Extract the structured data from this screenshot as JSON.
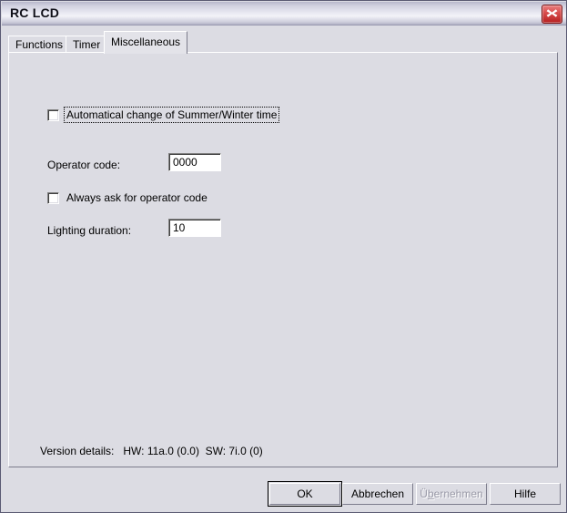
{
  "window": {
    "title": "RC LCD",
    "close_icon": "close-icon"
  },
  "tabs": [
    {
      "label": "Functions",
      "selected": false
    },
    {
      "label": "Timer",
      "selected": false
    },
    {
      "label": "Miscellaneous",
      "selected": true
    }
  ],
  "form": {
    "summer_winter": {
      "label": "Automatical change of Summer/Winter time",
      "checked": false,
      "focused": true
    },
    "operator_code": {
      "label": "Operator code:",
      "value": "0000"
    },
    "always_ask": {
      "label": "Always ask for operator code",
      "checked": false
    },
    "lighting_duration": {
      "label": "Lighting duration:",
      "value": "10"
    }
  },
  "version": {
    "label": "Version details:",
    "hardware": "HW: 11a.0 (0.0)",
    "software": "SW: 7i.0 (0)",
    "full_text": "Version details:   HW: 11a.0 (0.0)  SW: 7i.0 (0)"
  },
  "buttons": {
    "ok": "OK",
    "cancel": "Abbrechen",
    "apply_before": "Ü",
    "apply_accel": "b",
    "apply_after": "ernehmen",
    "apply_full": "Übernehmen",
    "help": "Hilfe"
  },
  "colors": {
    "dialog_background": "#dcdce3",
    "panel_background": "#dcdce3",
    "titlebar_light": "#f3f3f8",
    "titlebar_dark": "#b0b0c4",
    "close_red": "#b62020",
    "disabled_text": "#9a9aa8",
    "window_border": "#5b5b73"
  }
}
